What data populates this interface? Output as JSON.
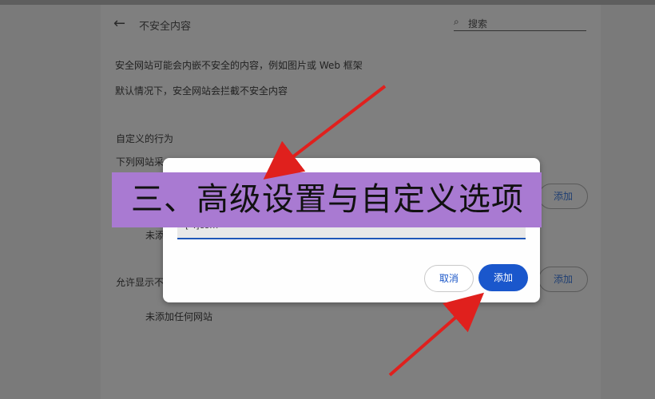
{
  "header": {
    "back_icon": "back-arrow-icon",
    "title": "不安全内容",
    "search_icon": "search-icon",
    "search_placeholder": "搜索"
  },
  "content": {
    "desc1": "安全网站可能会内嵌不安全的内容，例如图片或 Web 框架",
    "desc2": "默认情况下，安全网站会拦截不安全内容",
    "custom_title": "自定义的行为",
    "custom_sub": "下列网站采",
    "block_empty": "未添",
    "allow_title": "允许显示不",
    "allow_empty": "未添加任何网站",
    "add_button_1": "添加",
    "add_button_2": "添加"
  },
  "dialog": {
    "input_value": "[*.]com",
    "cancel_label": "取消",
    "add_label": "添加"
  },
  "banner": {
    "text": "三、高级设置与自定义选项"
  },
  "colors": {
    "overlay": "#7f7f7f",
    "primary": "#1a57cc",
    "banner": "#a97ad2",
    "arrow": "#e0201d"
  }
}
